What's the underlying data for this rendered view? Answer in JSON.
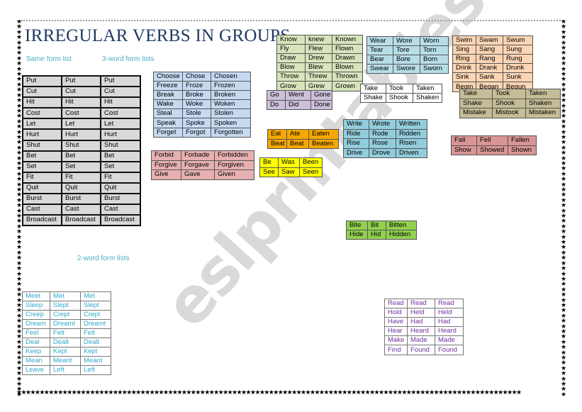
{
  "title": "IRREGULAR VERBS IN GROUPS",
  "labels": {
    "same_form": "Same form list",
    "three_word": "3-word form lists",
    "two_word": "2-word form lists"
  },
  "watermark": "eslprintables.com",
  "colors": {
    "title": "#1f3864",
    "label": "#4bacc6",
    "same": "#d9d9d9",
    "choose": "#c6d9f1",
    "forbid": "#e6b0b0",
    "know": "#d7e4bc",
    "go": "#ccc0da",
    "take_white": "#ffffff",
    "wear": "#b7dee8",
    "swim": "#fcd5b4",
    "take_olive": "#c4bd97",
    "eat": "#f5a800",
    "be": "#ffff00",
    "write": "#92cddc",
    "fall": "#d99594",
    "bite": "#92d050",
    "meet": "#ffffff",
    "read": "#ffffff"
  },
  "tables": {
    "same": [
      [
        "Put",
        "Put",
        "Put"
      ],
      [
        "Cut",
        "Cut",
        "Cut"
      ],
      [
        "Hit",
        "Hit",
        "Hit"
      ],
      [
        "Cost",
        "Cost",
        "Cost"
      ],
      [
        "Let",
        "Let",
        "Let"
      ],
      [
        "Hurt",
        "Hurt",
        "Hurt"
      ],
      [
        " Shut",
        "Shut",
        "Shut"
      ],
      [
        "Bet",
        "Bet",
        "Bet"
      ],
      [
        "Set",
        "Set",
        "Set"
      ],
      [
        "Fit",
        "Fit",
        "Fit"
      ],
      [
        "Quit",
        "Quit",
        "Quit"
      ],
      [
        "Burst",
        "Burst",
        "Burst"
      ],
      [
        "Cast",
        "Cast",
        "Cast"
      ],
      [
        "Broadcast",
        "Broadcast",
        "Broadcast"
      ]
    ],
    "choose": [
      [
        "Choose",
        "Chose",
        "Chosen"
      ],
      [
        "Freeze",
        "Froze",
        "Frozen"
      ],
      [
        "Break",
        "Broke",
        "Broken"
      ],
      [
        "Wake",
        "Woke",
        "Woken"
      ],
      [
        "Steal",
        "Stole",
        "Stolen"
      ],
      [
        "Speak",
        "Spoke",
        "Spoken"
      ],
      [
        "Forget",
        "Forgot",
        "Forgotten"
      ]
    ],
    "forbid": [
      [
        "Forbid",
        "Forbade",
        "Forbidden"
      ],
      [
        "Forgive",
        "Forgave",
        "Forgiven"
      ],
      [
        "Give",
        "Gave",
        "Given"
      ]
    ],
    "know": [
      [
        "Know",
        "knew",
        "Known"
      ],
      [
        "Fly",
        "Flew",
        "Flown"
      ],
      [
        "Draw",
        "Drew",
        "Drawn"
      ],
      [
        "Blow",
        "Blew",
        "Blown"
      ],
      [
        "Throw",
        "Threw",
        "Thrown"
      ],
      [
        "Grow",
        "Grew",
        "Grown"
      ]
    ],
    "go": [
      [
        "Go",
        "Went",
        "Gone"
      ],
      [
        "Do",
        "Did",
        "Done"
      ]
    ],
    "take_white": [
      [
        "Take",
        "Took",
        "Taken"
      ],
      [
        "Shake",
        "Shook",
        "Shaken"
      ]
    ],
    "wear": [
      [
        "Wear",
        "Wore",
        "Worn"
      ],
      [
        "Tear",
        "Tore",
        "Torn"
      ],
      [
        "Bear",
        "Bore",
        "Born"
      ],
      [
        "Swear",
        "Swore",
        "Sworn"
      ]
    ],
    "swim": [
      [
        "Swim",
        "Swam",
        "Swum"
      ],
      [
        "Sing",
        "Sang",
        "Sung"
      ],
      [
        "Ring",
        "Rang",
        "Rung"
      ],
      [
        "Drink",
        "Drank",
        "Drunk"
      ],
      [
        "Sink",
        "Sank",
        "Sunk"
      ],
      [
        "Begin",
        "Began",
        "Begun"
      ]
    ],
    "take_olive": [
      [
        "Take",
        "Took",
        "Taken"
      ],
      [
        "Shake",
        "Shook",
        "Shaken"
      ],
      [
        "Mistake",
        "Mistook",
        "Mistaken"
      ]
    ],
    "eat": [
      [
        "Eat",
        "Ate",
        "Eaten"
      ],
      [
        "Beat",
        "Beat",
        "Beaten"
      ]
    ],
    "be": [
      [
        "Be",
        "Was",
        "Been"
      ],
      [
        "See",
        "Saw",
        "Seen"
      ]
    ],
    "write": [
      [
        "Write",
        "Wrote",
        "Written"
      ],
      [
        "Ride",
        "Rode",
        "Ridden"
      ],
      [
        "Rise",
        "Rose",
        "Risen"
      ],
      [
        "Drive",
        "Drove",
        "Driven"
      ]
    ],
    "fall": [
      [
        "Fall",
        "Fell",
        "Fallen"
      ],
      [
        "Show",
        "Showed",
        "Shown"
      ]
    ],
    "bite": [
      [
        "Bite",
        "Bit",
        "Bitten"
      ],
      [
        "Hide",
        "Hid",
        "Hidden"
      ]
    ],
    "meet": [
      [
        "Meet",
        "Met",
        "Met"
      ],
      [
        " Sleep",
        "Slept",
        "Slept"
      ],
      [
        "Creep",
        "Crept",
        "Crept"
      ],
      [
        "Dream",
        "Dreamt",
        "Dreamt"
      ],
      [
        "Feel",
        "Felt",
        "Felt"
      ],
      [
        "Deal",
        "Dealt",
        "Dealt"
      ],
      [
        "Keep",
        "Kept",
        "Kept"
      ],
      [
        "Mean",
        "Meant",
        "Meant"
      ],
      [
        "Leave",
        "Left",
        "Left"
      ]
    ],
    "read": [
      [
        "Read",
        "Read",
        "Read"
      ],
      [
        "Hold",
        "Held",
        "Held"
      ],
      [
        "Have",
        "Had",
        "Had"
      ],
      [
        "Hear",
        "Heard",
        "Heard"
      ],
      [
        "Make",
        "Made",
        "Made"
      ],
      [
        "Find",
        "Found",
        "Found"
      ]
    ]
  }
}
